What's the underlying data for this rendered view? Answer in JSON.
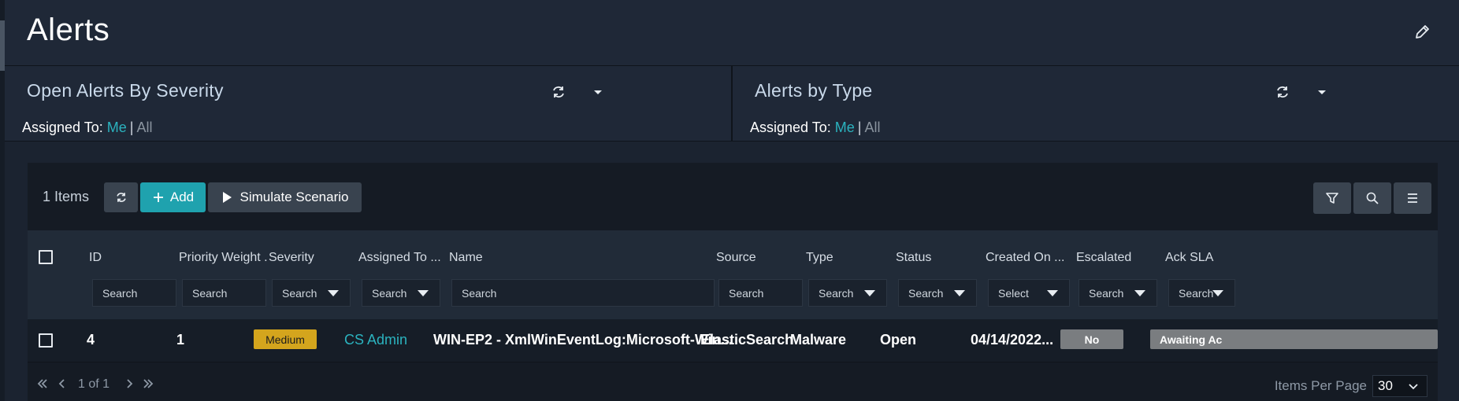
{
  "page": {
    "title": "Alerts"
  },
  "widgets": [
    {
      "title": "Open Alerts By Severity",
      "assigned_label": "Assigned To:",
      "me": "Me",
      "sep": "|",
      "all": "All"
    },
    {
      "title": "Alerts by Type",
      "assigned_label": "Assigned To:",
      "me": "Me",
      "sep": "|",
      "all": "All"
    }
  ],
  "toolbar": {
    "count": "1 Items",
    "add_label": "Add",
    "simulate_label": "Simulate Scenario"
  },
  "columns": [
    {
      "label": "ID",
      "filter": "Search"
    },
    {
      "label": "Priority Weight .",
      "filter": "Search"
    },
    {
      "label": "Severity",
      "filter": "Search"
    },
    {
      "label": "Assigned To ...",
      "filter": "Search"
    },
    {
      "label": "Name",
      "filter": "Search"
    },
    {
      "label": "Source",
      "filter": "Search"
    },
    {
      "label": "Type",
      "filter": "Search"
    },
    {
      "label": "Status",
      "filter": "Search"
    },
    {
      "label": "Created On ...",
      "filter": "Select"
    },
    {
      "label": "Escalated",
      "filter": "Search"
    },
    {
      "label": "Ack SLA",
      "filter": "Search"
    }
  ],
  "rows": [
    {
      "id": "4",
      "priority_weight": "1",
      "severity": "Medium",
      "assigned_to": "CS Admin",
      "name": "WIN-EP2 - XmlWinEventLog:Microsoft-Win...",
      "source": "ElasticSearch",
      "type": "Malware",
      "status": "Open",
      "created_on": "04/14/2022...",
      "escalated": "No",
      "ack_sla": "Awaiting Ac"
    }
  ],
  "pager": {
    "page_info": "1 of 1",
    "items_per_page_label": "Items Per Page",
    "items_per_page": "30"
  },
  "colors": {
    "accent": "#1fa2ae",
    "link": "#2bb3bf",
    "severity_medium": "#d4a51d",
    "badge_gray": "#7a7d80"
  },
  "icons": [
    "edit-icon",
    "refresh-icon",
    "caret-down-icon",
    "plus-icon",
    "play-icon",
    "filter-icon",
    "search-icon",
    "menu-icon",
    "first-page-icon",
    "prev-page-icon",
    "next-page-icon",
    "last-page-icon",
    "chevron-down-icon"
  ]
}
